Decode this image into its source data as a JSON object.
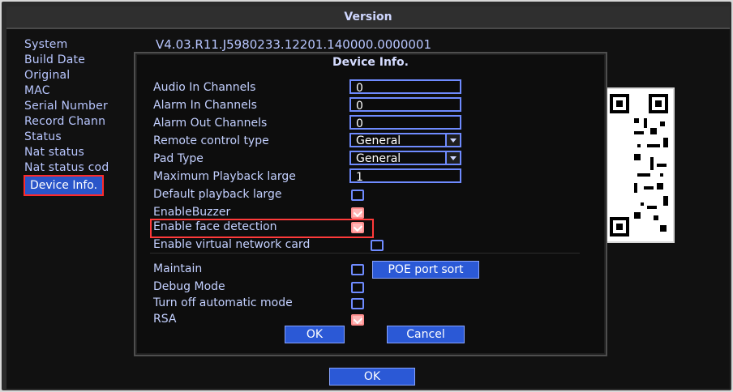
{
  "window": {
    "title": "Version"
  },
  "left_panel": {
    "items": [
      "System",
      "Build Date",
      "Original",
      "MAC",
      "Serial Number",
      "Record Chann",
      "Status",
      "Nat status",
      "Nat status cod"
    ],
    "device_info_button": "Device Info."
  },
  "version": {
    "value": "V4.03.R11.J5980233.12201.140000.0000001"
  },
  "dialog": {
    "title": "Device Info.",
    "rows": {
      "audio_in_channels": {
        "label": "Audio In Channels",
        "value": "0"
      },
      "alarm_in_channels": {
        "label": "Alarm In Channels",
        "value": "0"
      },
      "alarm_out_channels": {
        "label": "Alarm Out Channels",
        "value": "0"
      },
      "remote_control_type": {
        "label": "Remote control type",
        "value": "General"
      },
      "pad_type": {
        "label": "Pad Type",
        "value": "General"
      },
      "maximum_playback_large": {
        "label": "Maximum Playback large",
        "value": "1"
      },
      "default_playback_large": {
        "label": "Default playback large",
        "checked": false
      },
      "enable_buzzer": {
        "label": "EnableBuzzer",
        "checked": true
      },
      "enable_face_detection": {
        "label": "Enable face detection",
        "checked": true
      },
      "enable_virtual_network_card": {
        "label": "Enable virtual network card",
        "checked": false
      },
      "maintain": {
        "label": "Maintain",
        "checked": false
      },
      "debug_mode": {
        "label": "Debug Mode",
        "checked": false
      },
      "turn_off_automatic_mode": {
        "label": "Turn off automatic mode",
        "checked": false
      },
      "rsa": {
        "label": "RSA",
        "checked": true
      }
    },
    "buttons": {
      "poe_port_sort": "POE port sort",
      "ok": "OK",
      "cancel": "Cancel"
    }
  },
  "footer": {
    "ok": "OK"
  },
  "icons": {
    "qr_code": "qr-code-icon"
  },
  "colors": {
    "accent_blue": "#2b59d6",
    "highlight_red": "#ff3a3a",
    "text_light_blue": "#b8c6ff"
  }
}
